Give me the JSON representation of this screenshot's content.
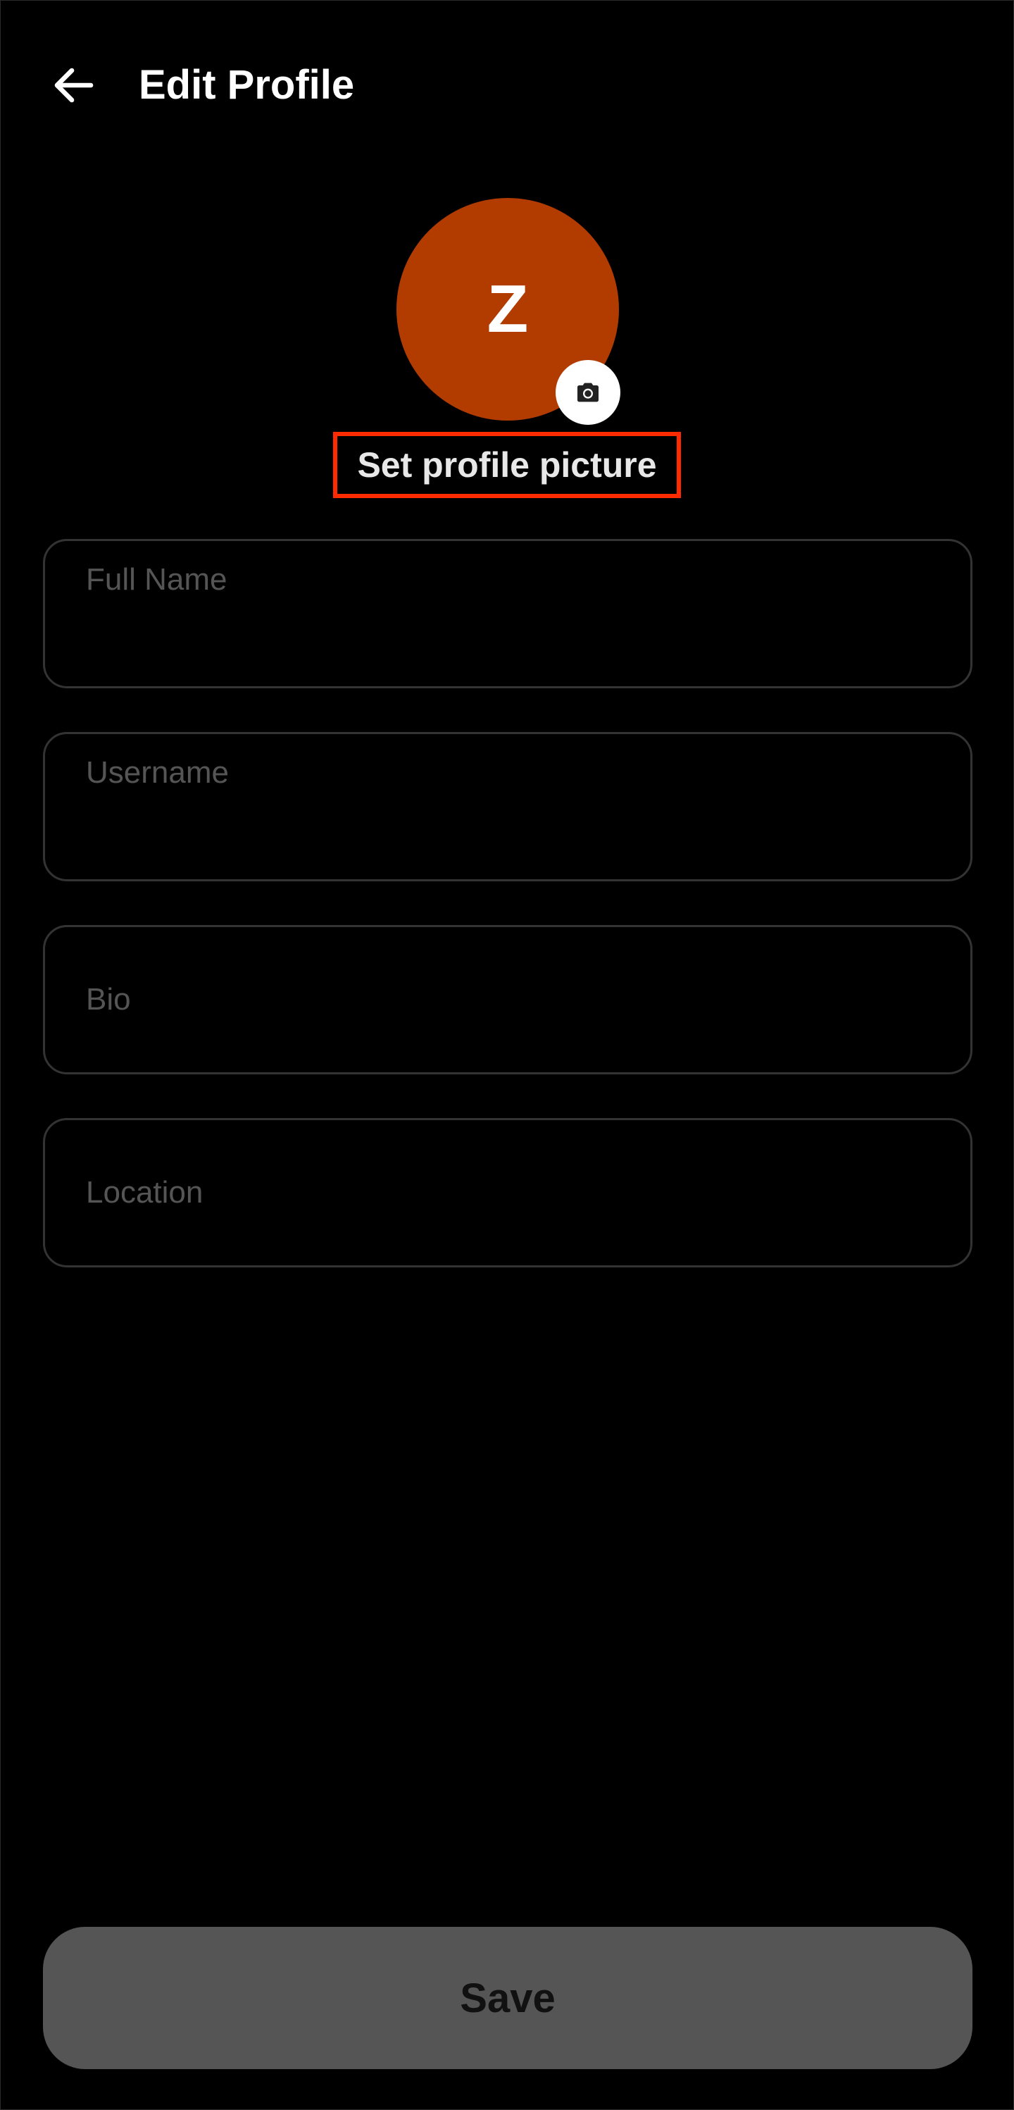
{
  "header": {
    "back_icon": "arrow-left-icon",
    "title": "Edit Profile"
  },
  "avatar": {
    "initial": "Z",
    "background_color": "#b23c00",
    "camera_icon": "camera-icon",
    "set_picture_label": "Set profile picture",
    "highlight_color": "#ff2a00"
  },
  "form": {
    "full_name": {
      "label": "Full Name",
      "value": ""
    },
    "username": {
      "label": "Username",
      "value": ""
    },
    "bio": {
      "placeholder": "Bio",
      "value": ""
    },
    "location": {
      "placeholder": "Location",
      "value": ""
    }
  },
  "actions": {
    "save_label": "Save",
    "save_color": "#555555"
  }
}
